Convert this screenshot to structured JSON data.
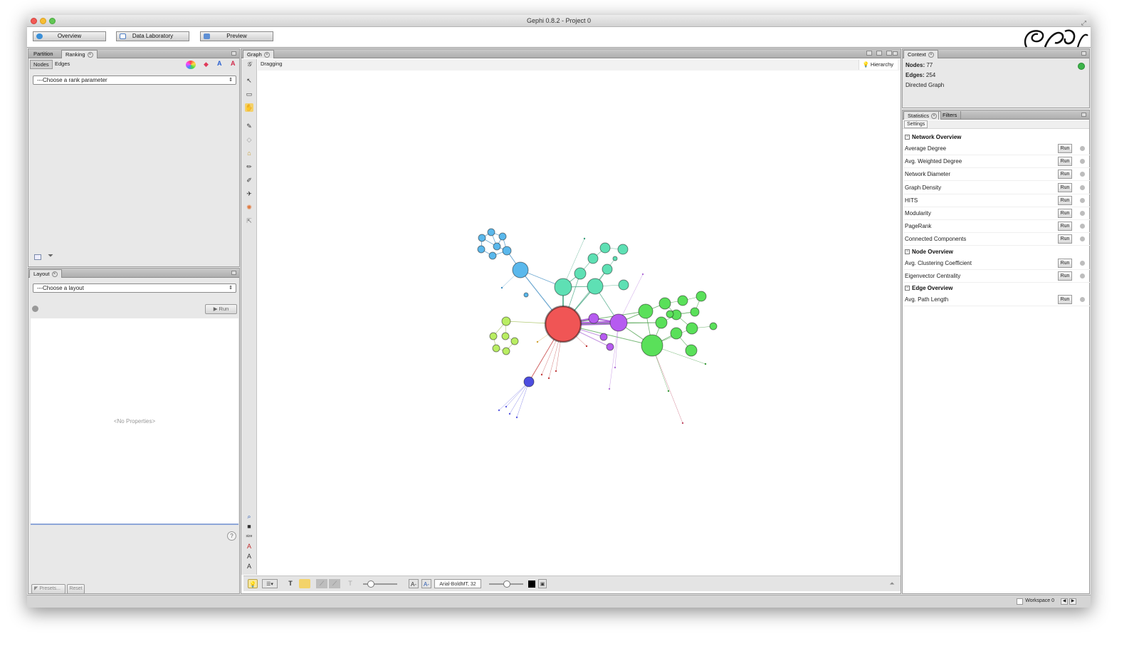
{
  "window": {
    "title": "Gephi 0.8.2 - Project 0"
  },
  "toolbar": {
    "overview": "Overview",
    "data_laboratory": "Data Laboratory",
    "preview": "Preview"
  },
  "left_top_panel": {
    "tabs": [
      "Partition",
      "Ranking"
    ],
    "subtabs": [
      "Nodes",
      "Edges"
    ],
    "rank_select": "---Choose a rank parameter"
  },
  "layout_panel": {
    "tab": "Layout",
    "layout_select": "---Choose a layout",
    "run": "Run",
    "no_properties": "<No Properties>",
    "presets": "Presets...",
    "reset": "Reset",
    "help": "?"
  },
  "graph_panel": {
    "tab": "Graph",
    "mode": "Dragging",
    "hierarchy": "Hierarchy",
    "font_label": "Arial-BoldMT, 32"
  },
  "context_panel": {
    "tab": "Context",
    "nodes_label": "Nodes:",
    "nodes_value": "77",
    "edges_label": "Edges:",
    "edges_value": "254",
    "graph_type": "Directed Graph"
  },
  "statistics_panel": {
    "tabs": [
      "Statistics",
      "Filters"
    ],
    "settings": "Settings",
    "run_label": "Run",
    "sections": [
      {
        "title": "Network Overview",
        "items": [
          "Average Degree",
          "Avg. Weighted Degree",
          "Network Diameter",
          "Graph Density",
          "HITS",
          "Modularity",
          "PageRank",
          "Connected Components"
        ]
      },
      {
        "title": "Node Overview",
        "items": [
          "Avg. Clustering Coefficient",
          "Eigenvector Centrality"
        ]
      },
      {
        "title": "Edge Overview",
        "items": [
          "Avg. Path Length"
        ]
      }
    ]
  },
  "status_bar": {
    "workspace": "Workspace 0"
  },
  "colors": {
    "hub_red": "#f05555",
    "purple": "#b65bf0",
    "green": "#5ae05a",
    "teal": "#5ee0b4",
    "blue": "#5ab8ec",
    "lime": "#b9ee62",
    "navy": "#4d4de0"
  }
}
